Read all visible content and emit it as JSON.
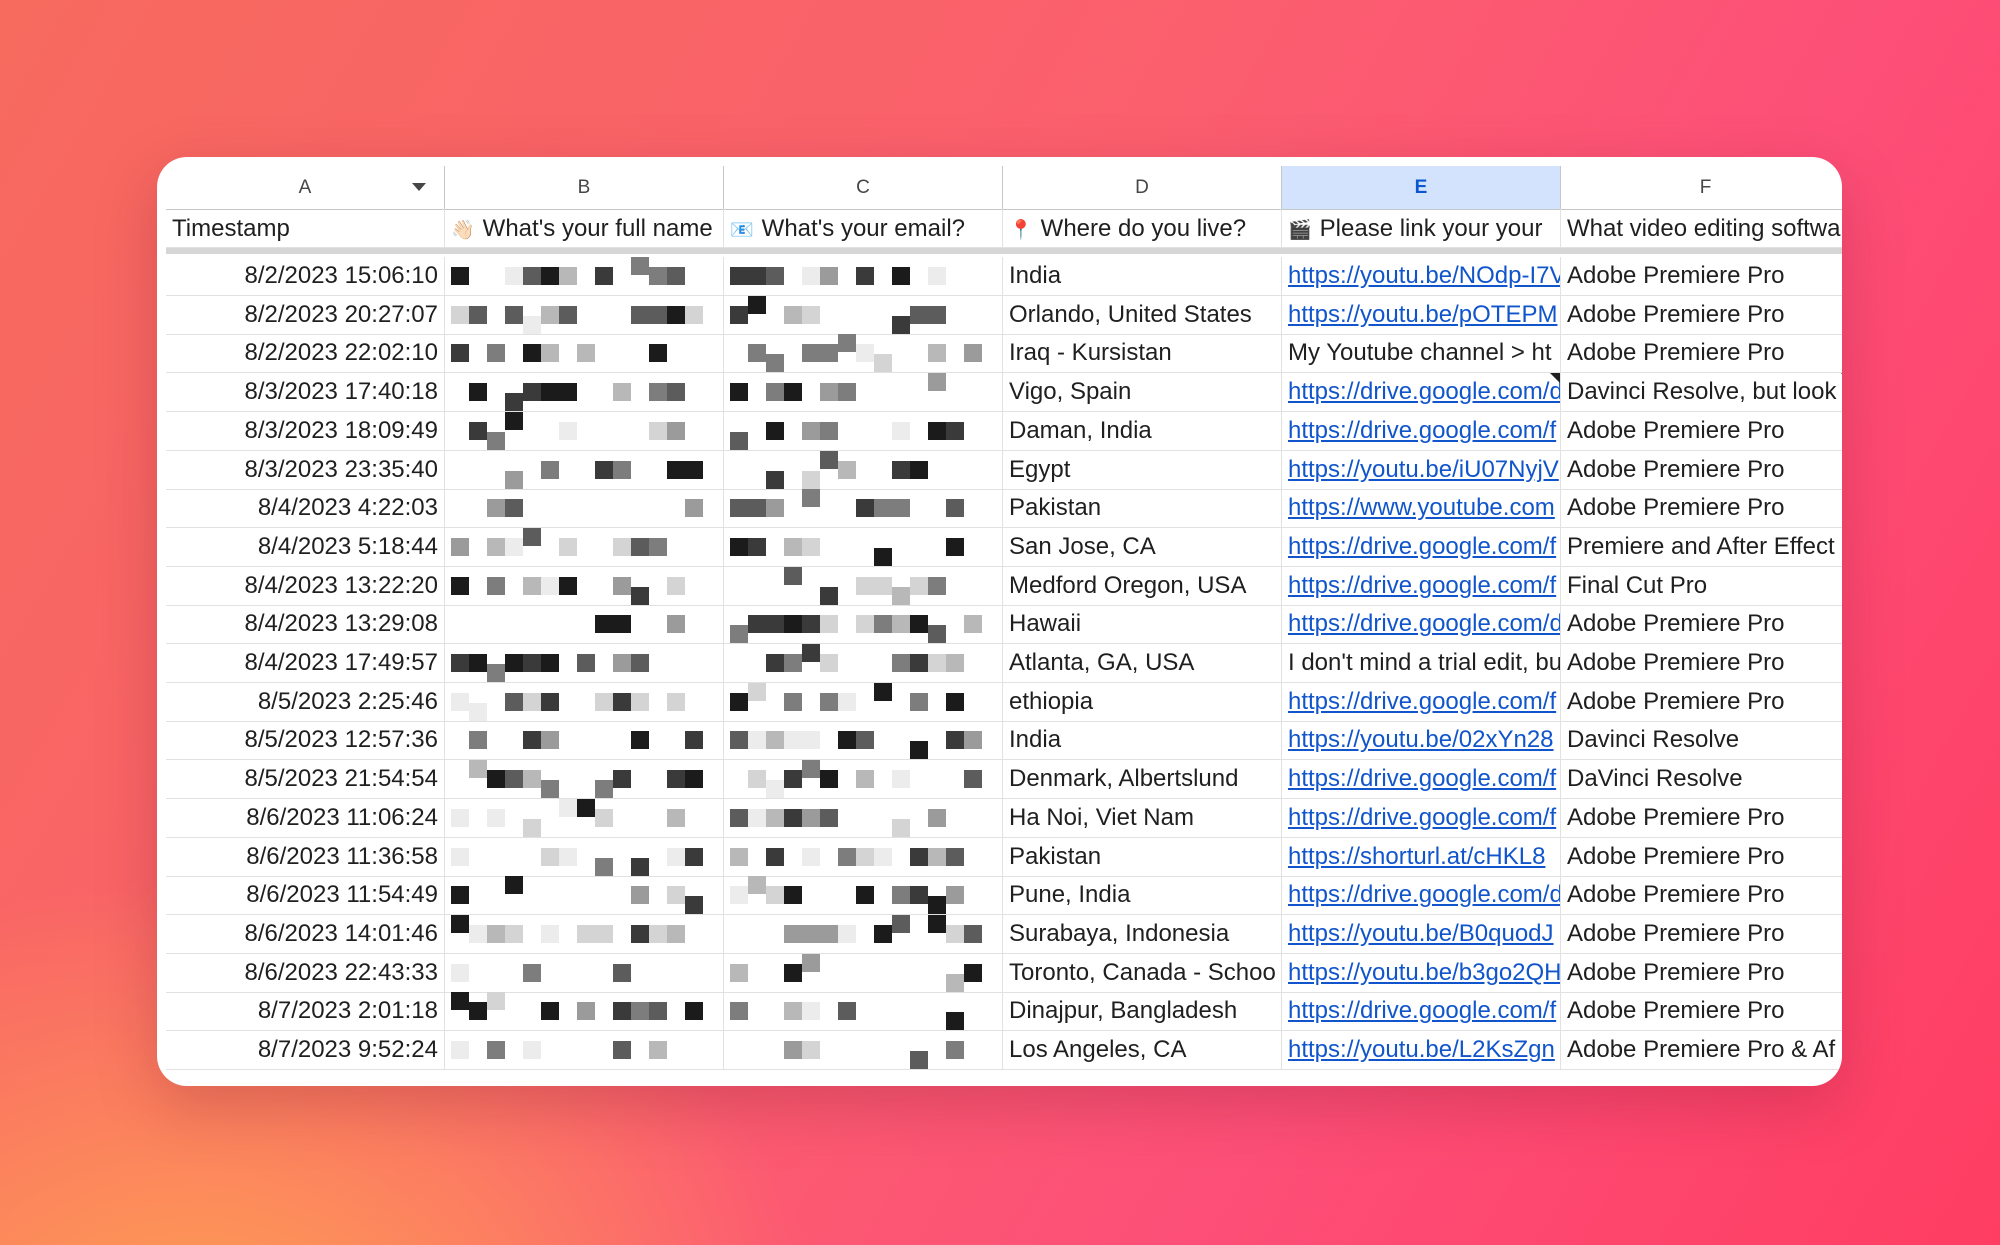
{
  "columns": [
    {
      "letter": "A",
      "header": "Timestamp",
      "emoji": ""
    },
    {
      "letter": "B",
      "header": "What's your full name",
      "emoji": "👋🏻"
    },
    {
      "letter": "C",
      "header": "What's your email?",
      "emoji": "📧"
    },
    {
      "letter": "D",
      "header": "Where do you live?",
      "emoji": "📍"
    },
    {
      "letter": "E",
      "header": "Please link your your",
      "emoji": "🎬"
    },
    {
      "letter": "F",
      "header": "What video editing softwa",
      "emoji": ""
    }
  ],
  "selected_column": "E",
  "rows": [
    {
      "timestamp": "8/2/2023 15:06:10",
      "location": "India",
      "link": "https://youtu.be/NOdp-I7V",
      "link_is_url": true,
      "software": "Adobe Premiere Pro"
    },
    {
      "timestamp": "8/2/2023 20:27:07",
      "location": "Orlando, United States",
      "link": "https://youtu.be/pOTEPM",
      "link_is_url": true,
      "software": "Adobe Premiere Pro"
    },
    {
      "timestamp": "8/2/2023 22:02:10",
      "location": "Iraq - Kursistan",
      "link": "My Youtube channel > ht",
      "link_is_url": false,
      "software": "Adobe Premiere Pro"
    },
    {
      "timestamp": "8/3/2023 17:40:18",
      "location": "Vigo, Spain",
      "link": "https://drive.google.com/d",
      "link_is_url": true,
      "software": "Davinci Resolve, but look",
      "note_e": true,
      "note_f": true
    },
    {
      "timestamp": "8/3/2023 18:09:49",
      "location": "Daman, India",
      "link": "https://drive.google.com/f",
      "link_is_url": true,
      "software": "Adobe Premiere Pro"
    },
    {
      "timestamp": "8/3/2023 23:35:40",
      "location": "Egypt",
      "link": "https://youtu.be/iU07NyjV",
      "link_is_url": true,
      "software": "Adobe Premiere Pro"
    },
    {
      "timestamp": "8/4/2023 4:22:03",
      "location": "Pakistan",
      "link": "https://www.youtube.com",
      "link_is_url": true,
      "software": "Adobe Premiere Pro"
    },
    {
      "timestamp": "8/4/2023 5:18:44",
      "location": "San Jose, CA",
      "link": "https://drive.google.com/f",
      "link_is_url": true,
      "software": "Premiere and After Effect"
    },
    {
      "timestamp": "8/4/2023 13:22:20",
      "location": "Medford Oregon, USA",
      "link": "https://drive.google.com/f",
      "link_is_url": true,
      "software": "Final Cut Pro"
    },
    {
      "timestamp": "8/4/2023 13:29:08",
      "location": "Hawaii",
      "link": "https://drive.google.com/d",
      "link_is_url": true,
      "software": "Adobe Premiere Pro"
    },
    {
      "timestamp": "8/4/2023 17:49:57",
      "location": "Atlanta, GA, USA",
      "link": "I don't mind a trial edit, bu",
      "link_is_url": false,
      "software": "Adobe Premiere Pro"
    },
    {
      "timestamp": "8/5/2023 2:25:46",
      "location": "ethiopia",
      "link": "https://drive.google.com/f",
      "link_is_url": true,
      "software": "Adobe Premiere Pro"
    },
    {
      "timestamp": "8/5/2023 12:57:36",
      "location": "India",
      "link": "https://youtu.be/02xYn28",
      "link_is_url": true,
      "software": "Davinci Resolve"
    },
    {
      "timestamp": "8/5/2023 21:54:54",
      "location": "Denmark, Albertslund",
      "link": "https://drive.google.com/f",
      "link_is_url": true,
      "software": "DaVinci Resolve"
    },
    {
      "timestamp": "8/6/2023 11:06:24",
      "location": "Ha Noi, Viet Nam",
      "link": "https://drive.google.com/f",
      "link_is_url": true,
      "software": "Adobe Premiere Pro"
    },
    {
      "timestamp": "8/6/2023 11:36:58",
      "location": "Pakistan",
      "link": "https://shorturl.at/cHKL8",
      "link_is_url": true,
      "software": "Adobe Premiere Pro"
    },
    {
      "timestamp": "8/6/2023 11:54:49",
      "location": "Pune, India",
      "link": "https://drive.google.com/d",
      "link_is_url": true,
      "software": "Adobe Premiere Pro"
    },
    {
      "timestamp": "8/6/2023 14:01:46",
      "location": "Surabaya, Indonesia",
      "link": "https://youtu.be/B0quodJ",
      "link_is_url": true,
      "software": "Adobe Premiere Pro"
    },
    {
      "timestamp": "8/6/2023 22:43:33",
      "location": "Toronto, Canada - Schoo",
      "link": "https://youtu.be/b3go2QH",
      "link_is_url": true,
      "software": "Adobe Premiere Pro"
    },
    {
      "timestamp": "8/7/2023 2:01:18",
      "location": "Dinajpur, Bangladesh",
      "link": "https://drive.google.com/f",
      "link_is_url": true,
      "software": "Adobe Premiere Pro"
    },
    {
      "timestamp": "8/7/2023 9:52:24",
      "location": "Los Angeles, CA",
      "link": "https://youtu.be/L2KsZgn",
      "link_is_url": true,
      "software": "Adobe Premiere Pro & Af"
    }
  ]
}
